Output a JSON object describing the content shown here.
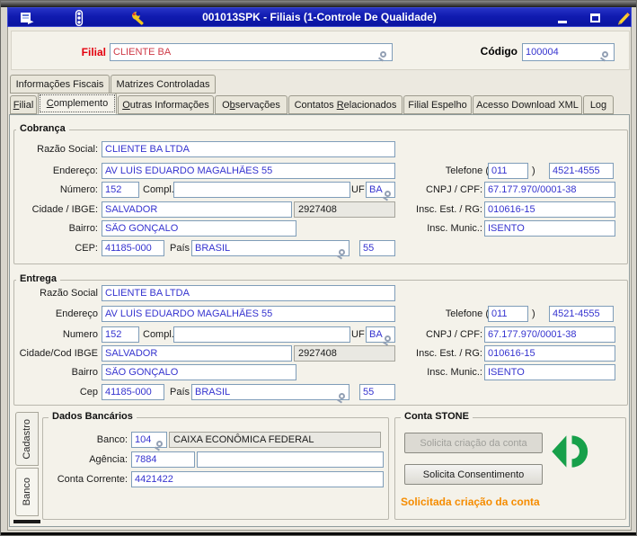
{
  "window": {
    "title": "001013SPK - Filiais (1-Controle De Qualidade)"
  },
  "colors": {
    "titlebar_blue": "#101bb0",
    "input_text_blue": "#3533cf",
    "filial_text_red": "#cf3a47",
    "label_red": "#e3000e",
    "status_orange": "#f58c00",
    "stone_green": "#17a04a"
  },
  "header": {
    "filial_label": "Filial",
    "filial_value": "CLIENTE BA",
    "codigo_label": "Código",
    "codigo_value": "100004"
  },
  "tabs_top": [
    {
      "label": "Informações Fiscais"
    },
    {
      "label": "Matrizes Controladas"
    }
  ],
  "tabs_main": [
    {
      "pre": "",
      "accel": "F",
      "post": "ilial"
    },
    {
      "pre": "",
      "accel": "C",
      "post": "omplemento"
    },
    {
      "pre": "",
      "accel": "O",
      "post": "utras Informações"
    },
    {
      "pre": "O",
      "accel": "b",
      "post": "servações"
    },
    {
      "pre": "Contatos ",
      "accel": "R",
      "post": "elacionados"
    },
    {
      "pre": "Filial Espelho",
      "accel": "",
      "post": ""
    },
    {
      "pre": "Acesso Download XML",
      "accel": "",
      "post": ""
    },
    {
      "pre": "Log",
      "accel": "",
      "post": ""
    }
  ],
  "cobranca": {
    "title": "Cobrança",
    "razao_label": "Razão Social:",
    "razao": "CLIENTE BA LTDA",
    "endereco_label": "Endereço:",
    "endereco": "AV LUÍS EDUARDO MAGALHÃES 55",
    "numero_label": "Número:",
    "numero": "152",
    "compl_label": "Compl.",
    "compl": "",
    "uf_label": "UF",
    "uf": "BA",
    "cidade_label": "Cidade / IBGE:",
    "cidade": "SALVADOR",
    "ibge": "2927408",
    "bairro_label": "Bairro:",
    "bairro": "SÃO GONÇALO",
    "cep_label": "CEP:",
    "cep": "41185-000",
    "pais_label": "País",
    "pais": "BRASIL",
    "pais_cod": "55",
    "tel_label": "Telefone (",
    "tel_close": ")",
    "ddd": "011",
    "fone": "4521-4555",
    "cnpj_label": "CNPJ / CPF:",
    "cnpj": "67.177.970/0001-38",
    "ie_label": "Insc. Est. / RG:",
    "ie": "010616-15",
    "im_label": "Insc. Munic.:",
    "im": "ISENTO"
  },
  "entrega": {
    "title": "Entrega",
    "razao_label": "Razão Social",
    "razao": "CLIENTE BA LTDA",
    "endereco_label": "Endereço",
    "endereco": "AV LUÍS EDUARDO MAGALHÃES 55",
    "numero_label": "Numero",
    "numero": "152",
    "compl_label": "Compl.",
    "compl": "",
    "uf_label": "UF",
    "uf": "BA",
    "cidade_label": "Cidade/Cod IBGE",
    "cidade": "SALVADOR",
    "ibge": "2927408",
    "bairro_label": "Bairro",
    "bairro": "SÃO GONÇALO",
    "cep_label": "Cep",
    "cep": "41185-000",
    "pais_label": "País",
    "pais": "BRASIL",
    "pais_cod": "55",
    "tel_label": "Telefone (",
    "tel_close": ")",
    "ddd": "011",
    "fone": "4521-4555",
    "cnpj_label": "CNPJ / CPF:",
    "cnpj": "67.177.970/0001-38",
    "ie_label": "Insc. Est. / RG:",
    "ie": "010616-15",
    "im_label": "Insc. Munic.:",
    "im": "ISENTO"
  },
  "bottom": {
    "side_tabs": [
      {
        "label": "Cadastro"
      },
      {
        "label": "Banco"
      }
    ],
    "dados": {
      "title": "Dados Bancários",
      "banco_label": "Banco:",
      "banco_code": "104",
      "banco_name": "CAIXA ECONÔMICA FEDERAL",
      "agencia_label": "Agência:",
      "agencia": "7884",
      "agencia_extra": "",
      "conta_label": "Conta Corrente:",
      "conta": "4421422"
    },
    "stone": {
      "title": "Conta STONE",
      "btn_create": "Solicita criação da conta",
      "btn_consent": "Solicita Consentimento",
      "status": "Solicitada criação da conta"
    }
  }
}
